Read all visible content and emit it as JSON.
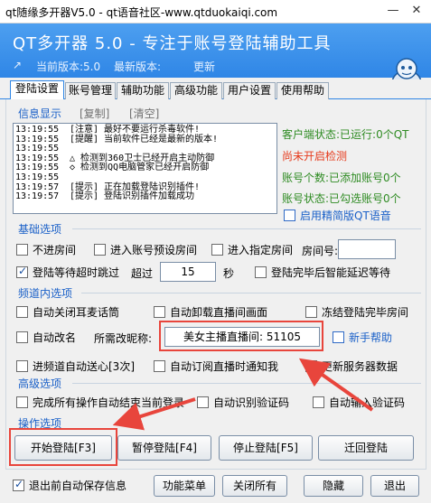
{
  "window": {
    "title": "qt随缘多开器V5.0 - qt语音社区-www.qtduokaiqi.com",
    "minimize_glyph": "—",
    "close_glyph": "✕"
  },
  "banner": {
    "title": "QT多开器 5.0 - 专注于账号登陆辅助工具",
    "arrow_glyph": "↗",
    "current_version_label": "当前版本:5.0",
    "latest_version_label": "最新版本:",
    "update_label": "更新"
  },
  "tabs": [
    "登陆设置",
    "账号管理",
    "辅助功能",
    "高级功能",
    "用户设置",
    "使用帮助"
  ],
  "info": {
    "title": "信息显示",
    "copy_label": "[复制]",
    "clear_label": "[清空]",
    "log": [
      {
        "time": "13:19:55",
        "msg": "[注意] 最好不要运行杀毒软件!"
      },
      {
        "time": "13:19:55",
        "msg": "[提醒] 当前软件已经是最新的版本!"
      },
      {
        "time": "13:19:55",
        "msg": ""
      },
      {
        "time": "13:19:55",
        "msg": "△ 检测到360卫士已经开启主动防御"
      },
      {
        "time": "13:19:55",
        "msg": "◇ 检测到QQ电脑管家已经开启防御"
      },
      {
        "time": "13:19:55",
        "msg": ""
      },
      {
        "time": "13:19:57",
        "msg": "[提示] 正在加载登陆识别插件!"
      },
      {
        "time": "13:19:57",
        "msg": "[提示] 登陆识别插件加载成功"
      }
    ]
  },
  "status": {
    "client": "客户端状态:已运行:0个QT",
    "detect": "尚未开启检测",
    "added": "账号个数:已添加账号0个",
    "checked": "账号状态:已勾选账号0个",
    "simple_ui": "启用精简版QT语音"
  },
  "basic": {
    "title": "基础选项",
    "no_room": "不进房间",
    "preset_room": "进入账号预设房间",
    "specified_room": "进入指定房间",
    "room_no_label": "房间号:",
    "room_no_value": "",
    "timeout_skip": "登陆等待超时跳过",
    "timeout_label": "超过",
    "timeout_value": "15",
    "seconds": "秒",
    "smart_delay": "登陆完毕后智能延迟等待"
  },
  "channel": {
    "title": "频道内选项",
    "auto_close_mic": "自动关闭耳麦话筒",
    "auto_unload_video": "自动卸载直播间画面",
    "freeze_room": "冻结登陆完毕房间",
    "auto_rename": "自动改名",
    "nickname_label": "所需改昵称:",
    "nickname_value": "美女主播直播间: 51105",
    "novice_help": "新手帮助",
    "auto_gift": "进频道自动送心[3次]",
    "auto_subscribe": "自动订阅直播时通知我",
    "update_server": "更新服务器数据"
  },
  "advanced": {
    "title": "高级选项",
    "exit_after": "完成所有操作自动结束当前登录",
    "auto_captcha": "自动识别验证码",
    "auto_input_captcha": "自动输入验证码"
  },
  "operation": {
    "title": "操作选项",
    "start": "开始登陆[F3]",
    "pause": "暂停登陆[F4]",
    "stop": "停止登陆[F5]",
    "back": "迁回登陆"
  },
  "bottom": {
    "auto_save": "退出前自动保存信息",
    "function_menu": "功能菜单",
    "close_all": "关闭所有",
    "hide": "隐藏",
    "exit": "退出"
  },
  "colors": {
    "accent": "#2f86e6",
    "status_green": "#2e8b22",
    "status_red": "#e63b1d",
    "highlight_red": "#e8453c"
  }
}
